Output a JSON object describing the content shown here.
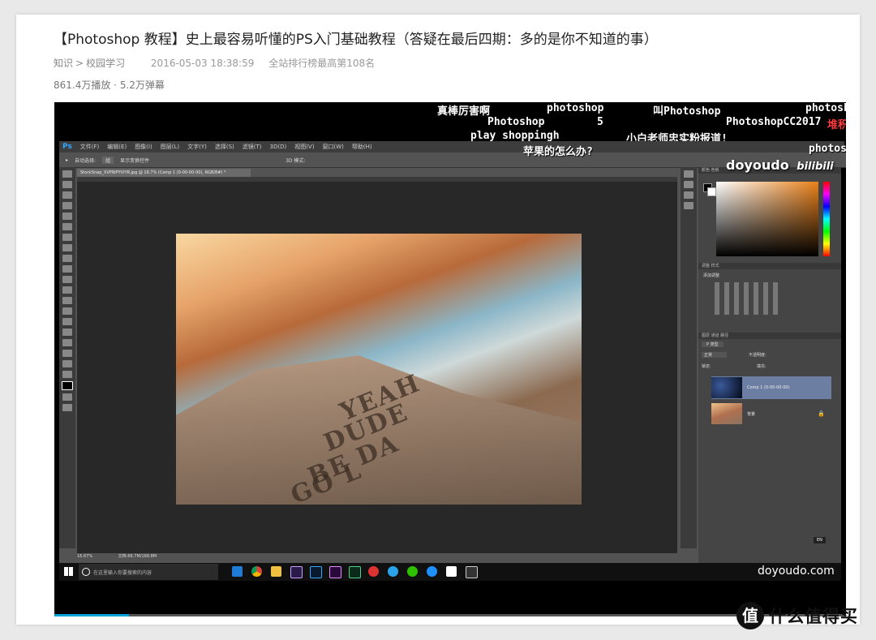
{
  "article": {
    "title": "【Photoshop 教程】史上最容易听懂的PS入门基础教程（答疑在最后四期：多的是你不知道的事）",
    "breadcrumb": [
      "知识",
      "校园学习"
    ],
    "breadcrumb_sep": ">",
    "datetime": "2016-05-03 18:38:59",
    "rank": "全站排行榜最高第108名",
    "plays": "861.4万播放",
    "danmaku_count": "5.2万弹幕",
    "stats_sep": " · "
  },
  "danmaku": [
    {
      "text": "真棒厉害啊",
      "color": "#ffffff"
    },
    {
      "text": "photoshop",
      "color": "#ffffff"
    },
    {
      "text": "叫Photoshop",
      "color": "#ffffff"
    },
    {
      "text": "photosh",
      "color": "#ffffff"
    },
    {
      "text": "Photoshop",
      "color": "#ffffff"
    },
    {
      "text": "5",
      "color": "#ffffff"
    },
    {
      "text": "PhotoshopCC2017",
      "color": "#ffffff"
    },
    {
      "text": "堆积",
      "color": "#ff3b3b"
    },
    {
      "text": "play shoppingh",
      "color": "#ffffff"
    },
    {
      "text": "小白老师忠实粉报道!",
      "color": "#ffffff"
    },
    {
      "text": "苹果的怎么办?",
      "color": "#ffffff"
    },
    {
      "text": "photos",
      "color": "#ffffff"
    }
  ],
  "photoshop": {
    "logo": "Ps",
    "menu": [
      "文件(F)",
      "编辑(E)",
      "图像(I)",
      "图层(L)",
      "文字(Y)",
      "选择(S)",
      "滤镜(T)",
      "3D(D)",
      "视图(V)",
      "窗口(W)",
      "帮助(H)"
    ],
    "options": [
      "自动选择:",
      "组",
      "显示变换控件",
      "3D 模式:"
    ],
    "doc_tab": "StockSnap_XVPWPYVIYR.jpg @ 16.7% (Comp 1 (0-00-00-00), RGB/8#) *",
    "panel_color": "颜色 色板",
    "panel_adjust": "调整 样式",
    "panel_adjust_sub": "添加调整",
    "panel_layers": "图层 通道 路径",
    "layers_kind": "P 类型",
    "layers_blend": "正常",
    "layers_opacity": "不透明度:",
    "layers_lock": "锁定:",
    "layers_fill": "填充:",
    "layers": [
      {
        "name": "Comp 1 (0-00-00-00)"
      },
      {
        "name": "背景"
      }
    ],
    "status_zoom": "16.67%",
    "status_doc": "文档:66.7M/168.8M",
    "carved_text": [
      "YEAH",
      "DUDE",
      "BE DA",
      "GO L"
    ]
  },
  "taskbar": {
    "search_placeholder": "在这里输入你要搜索的内容",
    "lang": "EN"
  },
  "watermark": {
    "channel": "doyoudo",
    "site_logo": "bilibili",
    "url": "doyoudo.com"
  },
  "brand": {
    "logo": "值",
    "name": "什么值得买"
  },
  "colors": {
    "accent": "#00a1d6",
    "ps_blue": "#31a8ff"
  }
}
